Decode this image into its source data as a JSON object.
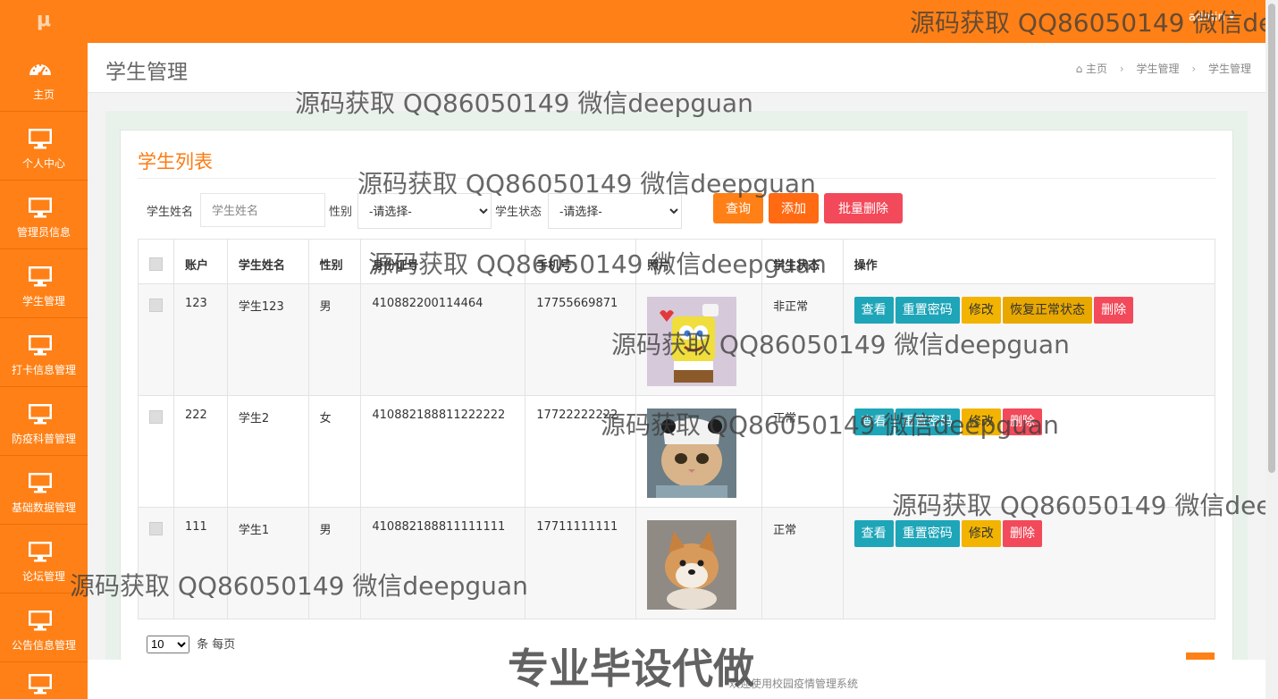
{
  "topbar": {
    "user_text": "admin ▾"
  },
  "sidebar": {
    "logo": "μ",
    "items": [
      {
        "label": "主页",
        "icon": "dashboard-icon"
      },
      {
        "label": "个人中心",
        "icon": "monitor-icon"
      },
      {
        "label": "管理员信息",
        "icon": "monitor-icon"
      },
      {
        "label": "学生管理",
        "icon": "monitor-icon"
      },
      {
        "label": "打卡信息管理",
        "icon": "monitor-icon"
      },
      {
        "label": "防疫科普管理",
        "icon": "monitor-icon"
      },
      {
        "label": "基础数据管理",
        "icon": "monitor-icon"
      },
      {
        "label": "论坛管理",
        "icon": "monitor-icon"
      },
      {
        "label": "公告信息管理",
        "icon": "monitor-icon"
      },
      {
        "label": "",
        "icon": "monitor-icon"
      }
    ]
  },
  "header": {
    "title": "学生管理",
    "breadcrumb": [
      "主页",
      "学生管理",
      "学生管理"
    ]
  },
  "card": {
    "title": "学生列表"
  },
  "filters": {
    "name_label": "学生姓名",
    "name_placeholder": "学生姓名",
    "gender_label": "性别",
    "gender_selected": "-请选择-",
    "status_label": "学生状态",
    "status_selected": "-请选择-"
  },
  "buttons": {
    "search": "查询",
    "add": "添加",
    "batch_delete": "批量删除"
  },
  "table": {
    "headers": [
      "",
      "账户",
      "学生姓名",
      "性别",
      "身份证号",
      "手机号",
      "照片",
      "学生状态",
      "操作"
    ],
    "rows": [
      {
        "account": "123",
        "name": "学生123",
        "gender": "男",
        "id_card": "410882200114464",
        "phone": "17755669871",
        "photo": "spongebob-photo",
        "status": "非正常",
        "actions": [
          "查看",
          "重置密码",
          "修改",
          "恢复正常状态",
          "删除"
        ]
      },
      {
        "account": "222",
        "name": "学生2",
        "gender": "女",
        "id_card": "410882188811222222",
        "phone": "17722222222",
        "photo": "cat-photo",
        "status": "正常",
        "actions": [
          "查看",
          "重置密码",
          "修改",
          "删除"
        ]
      },
      {
        "account": "111",
        "name": "学生1",
        "gender": "男",
        "id_card": "410882188811111111",
        "phone": "17711111111",
        "photo": "shiba-photo",
        "status": "正常",
        "actions": [
          "查看",
          "重置密码",
          "修改",
          "删除"
        ]
      }
    ]
  },
  "pager": {
    "page_size": "10",
    "per_page_text": "条 每页"
  },
  "footer": {
    "text": "欢迎使用校园疫情管理系统"
  },
  "watermarks": {
    "qq": "源码获取 QQ86050149 微信deepguan",
    "big": "专业毕设代做"
  },
  "colors": {
    "brand": "#ff8016",
    "teal": "#1ea5b8",
    "yellow": "#f2b400",
    "red": "#f24a5a"
  }
}
